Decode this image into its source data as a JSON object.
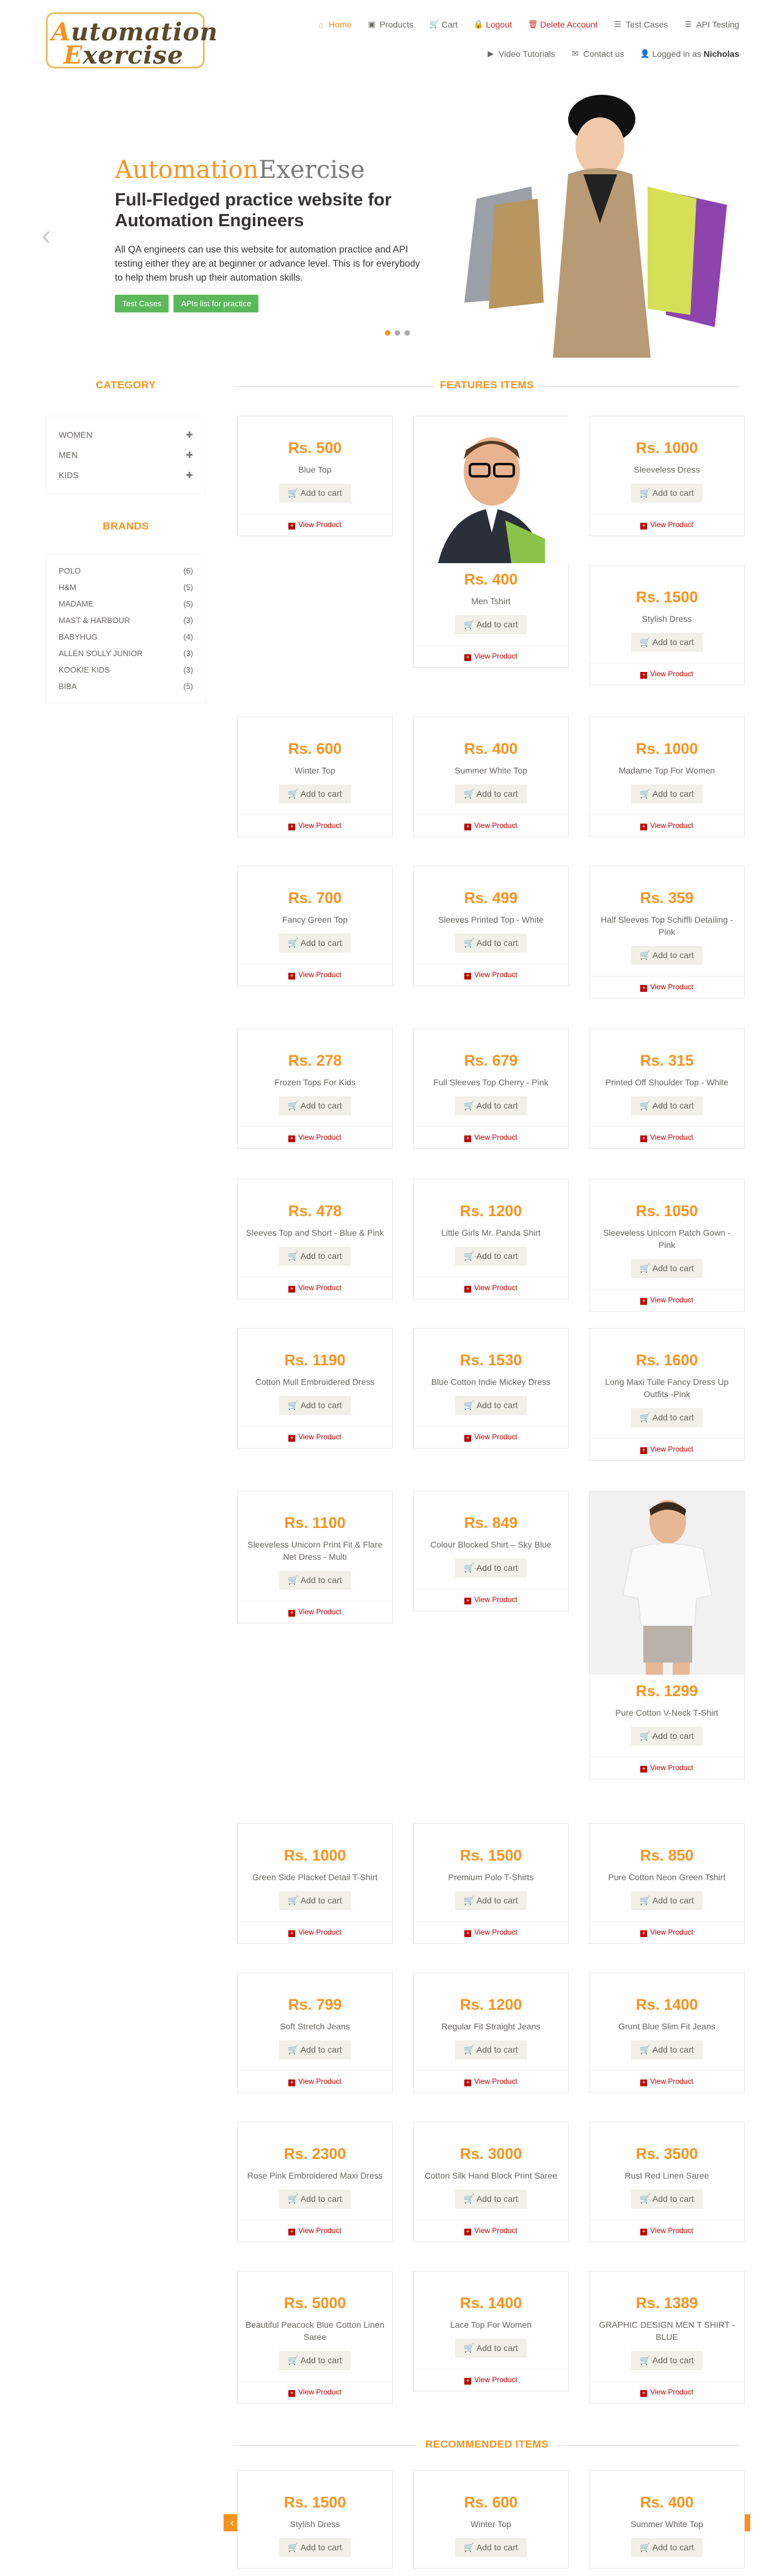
{
  "header": {
    "logo_line1": "Automation",
    "logo_line2": "Exercise",
    "nav": [
      {
        "label": "Home",
        "icon": "home-icon",
        "glyph": "⌂"
      },
      {
        "label": "Products",
        "icon": "products-icon",
        "glyph": "▣"
      },
      {
        "label": "Cart",
        "icon": "cart-icon",
        "glyph": "🛒"
      },
      {
        "label": "Logout",
        "icon": "lock-icon",
        "glyph": "🔒"
      },
      {
        "label": "Delete Account",
        "icon": "trash-icon",
        "glyph": "🗑"
      },
      {
        "label": "Test Cases",
        "icon": "list-icon",
        "glyph": "☰"
      },
      {
        "label": "API Testing",
        "icon": "list-icon",
        "glyph": "☰"
      },
      {
        "label": "Video Tutorials",
        "icon": "youtube-icon",
        "glyph": "▶"
      },
      {
        "label": "Contact us",
        "icon": "envelope-icon",
        "glyph": "✉"
      },
      {
        "label_prefix": "Logged in as",
        "user": "Nicholas",
        "icon": "user-icon",
        "glyph": "👤"
      }
    ]
  },
  "slider": {
    "title_a": "Automation",
    "title_b": "Exercise",
    "heading": "Full-Fledged practice website for Automation Engineers",
    "text": "All QA engineers can use this website for automation practice and API testing either they are at beginner or advance level. This is for everybody to help them brush up their automation skills.",
    "btn_test_cases": "Test Cases",
    "btn_apis": "APIs list for practice",
    "prev": "‹",
    "next": "›"
  },
  "sidebar": {
    "category_title": "CATEGORY",
    "categories": [
      "Women",
      "Men",
      "Kids"
    ],
    "brands_title": "BRANDS",
    "brands": [
      {
        "name": "Polo",
        "count": "(6)"
      },
      {
        "name": "H&M",
        "count": "(5)"
      },
      {
        "name": "Madame",
        "count": "(5)"
      },
      {
        "name": "Mast & Harbour",
        "count": "(3)"
      },
      {
        "name": "Babyhug",
        "count": "(4)"
      },
      {
        "name": "Allen Solly Junior",
        "count": "(3)"
      },
      {
        "name": "Kookie Kids",
        "count": "(3)"
      },
      {
        "name": "Biba",
        "count": "(5)"
      }
    ]
  },
  "features": {
    "title": "FEATURES ITEMS",
    "add_label": "Add to cart",
    "view_label": "View Product",
    "products": [
      {
        "price": "Rs. 500",
        "name": "Blue Top"
      },
      {
        "price": "Rs. 400",
        "name": "Men Tshirt"
      },
      {
        "price": "Rs. 1000",
        "name": "Sleeveless Dress"
      },
      {
        "price": "Rs. 1500",
        "name": "Stylish Dress"
      },
      {
        "price": "Rs. 600",
        "name": "Winter Top"
      },
      {
        "price": "Rs. 400",
        "name": "Summer White Top"
      },
      {
        "price": "Rs. 1000",
        "name": "Madame Top For Women"
      },
      {
        "price": "Rs. 700",
        "name": "Fancy Green Top"
      },
      {
        "price": "Rs. 499",
        "name": "Sleeves Printed Top - White"
      },
      {
        "price": "Rs. 359",
        "name": "Half Sleeves Top Schiffli Detailing - Pink"
      },
      {
        "price": "Rs. 278",
        "name": "Frozen Tops For Kids"
      },
      {
        "price": "Rs. 679",
        "name": "Full Sleeves Top Cherry - Pink"
      },
      {
        "price": "Rs. 315",
        "name": "Printed Off Shoulder Top - White"
      },
      {
        "price": "Rs. 478",
        "name": "Sleeves Top and Short - Blue & Pink"
      },
      {
        "price": "Rs. 1200",
        "name": "Little Girls Mr. Panda Shirt"
      },
      {
        "price": "Rs. 1050",
        "name": "Sleeveless Unicorn Patch Gown - Pink"
      },
      {
        "price": "Rs. 1190",
        "name": "Cotton Mull Embroidered Dress"
      },
      {
        "price": "Rs. 1530",
        "name": "Blue Cotton Indie Mickey Dress"
      },
      {
        "price": "Rs. 1600",
        "name": "Long Maxi Tulle Fancy Dress Up Outfits -Pink"
      },
      {
        "price": "Rs. 1100",
        "name": "Sleeveless Unicorn Print Fit & Flare Net Dress - Multi"
      },
      {
        "price": "Rs. 849",
        "name": "Colour Blocked Shirt – Sky Blue"
      },
      {
        "price": "Rs. 1299",
        "name": "Pure Cotton V-Neck T-Shirt"
      },
      {
        "price": "Rs. 1000",
        "name": "Green Side Placket Detail T-Shirt"
      },
      {
        "price": "Rs. 1500",
        "name": "Premium Polo T-Shirts"
      },
      {
        "price": "Rs. 850",
        "name": "Pure Cotton Neon Green Tshirt"
      },
      {
        "price": "Rs. 799",
        "name": "Soft Stretch Jeans"
      },
      {
        "price": "Rs. 1200",
        "name": "Regular Fit Straight Jeans"
      },
      {
        "price": "Rs. 1400",
        "name": "Grunt Blue Slim Fit Jeans"
      },
      {
        "price": "Rs. 2300",
        "name": "Rose Pink Embroidered Maxi Dress"
      },
      {
        "price": "Rs. 3000",
        "name": "Cotton Silk Hand Block Print Saree"
      },
      {
        "price": "Rs. 3500",
        "name": "Rust Red Linen Saree"
      },
      {
        "price": "Rs. 5000",
        "name": "Beautiful Peacock Blue Cotton Linen Saree"
      },
      {
        "price": "Rs. 1400",
        "name": "Lace Top For Women"
      },
      {
        "price": "Rs. 1389",
        "name": "GRAPHIC DESIGN MEN T SHIRT - BLUE"
      }
    ]
  },
  "recommended": {
    "title": "RECOMMENDED ITEMS",
    "prev": "‹",
    "next": "›",
    "products": [
      {
        "price": "Rs. 1500",
        "name": "Stylish Dress"
      },
      {
        "price": "Rs. 600",
        "name": "Winter Top"
      },
      {
        "price": "Rs. 400",
        "name": "Summer White Top"
      }
    ]
  },
  "colors": {
    "accent": "#f7931e",
    "green": "#5cb85c",
    "red": "#b00000"
  }
}
